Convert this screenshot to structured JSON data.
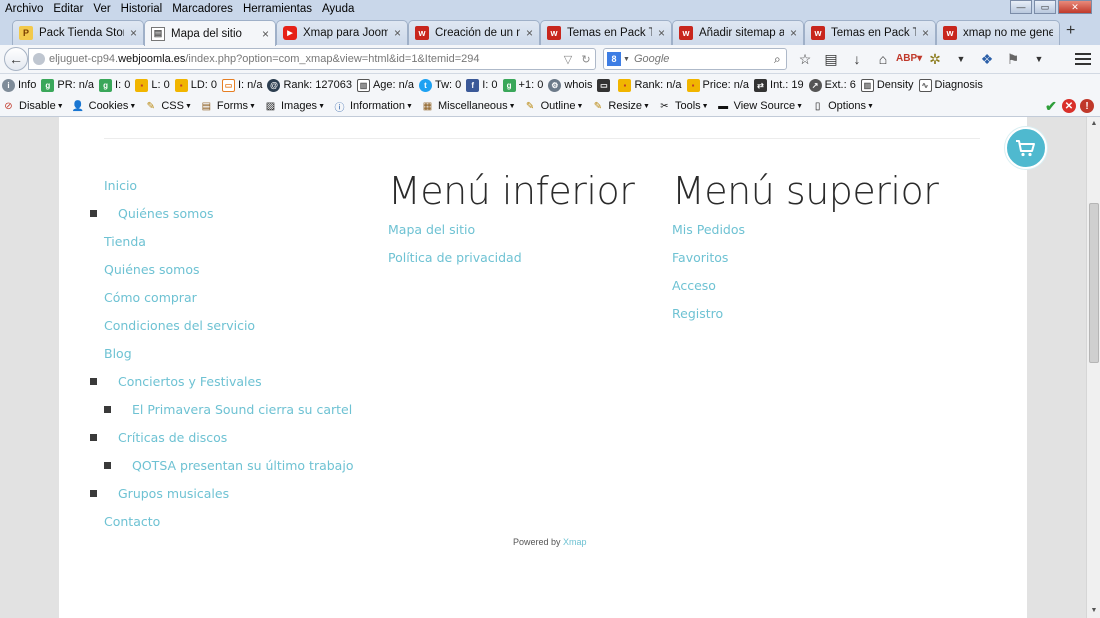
{
  "menubar": {
    "items": [
      "Archivo",
      "Editar",
      "Ver",
      "Historial",
      "Marcadores",
      "Herramientas",
      "Ayuda"
    ]
  },
  "tabs": [
    {
      "label": "Pack Tienda Store...",
      "icon": "pack-icon",
      "active": false
    },
    {
      "label": "Mapa del sitio",
      "icon": "page-icon",
      "active": true
    },
    {
      "label": "Xmap para Joomla...",
      "icon": "youtube-icon",
      "active": false
    },
    {
      "label": "Creación de un m...",
      "icon": "w-icon",
      "active": false
    },
    {
      "label": "Temas en Pack Ti...",
      "icon": "w-icon",
      "active": false
    },
    {
      "label": "Añadir sitemap a ...",
      "icon": "w-icon",
      "active": false
    },
    {
      "label": "Temas en Pack Ti...",
      "icon": "w-icon",
      "active": false
    },
    {
      "label": "xmap no me gene...",
      "icon": "w-icon",
      "active": false
    }
  ],
  "navbar": {
    "url_prefix": "eljuguet-cp94.",
    "url_domain": "webjoomla.es",
    "url_suffix": "/index.php?option=com_xmap&view=html&id=1&Itemid=294",
    "search_placeholder": "Google",
    "search_engine_label": "8"
  },
  "seobar": {
    "items": [
      {
        "icon": "info-icon",
        "text": "Info"
      },
      {
        "icon": "pagerank-icon",
        "text": "PR: n/a"
      },
      {
        "icon": "google-index-icon",
        "text": "I: 0"
      },
      {
        "icon": "links-icon",
        "text": "L: 0"
      },
      {
        "icon": "linkdomain-icon",
        "text": "LD: 0"
      },
      {
        "icon": "bing-index-icon",
        "text": "I: n/a"
      },
      {
        "icon": "alexa-icon",
        "text": "Rank: 127063"
      },
      {
        "icon": "age-icon",
        "text": "Age: n/a"
      },
      {
        "icon": "twitter-icon",
        "text": "Tw: 0"
      },
      {
        "icon": "facebook-icon",
        "text": "I: 0"
      },
      {
        "icon": "googleplus-icon",
        "text": "+1: 0"
      },
      {
        "icon": "whois-icon",
        "text": "whois"
      },
      {
        "icon": "source-icon",
        "text": ""
      },
      {
        "icon": "semrush-rank-icon",
        "text": "Rank: n/a"
      },
      {
        "icon": "semrush-price-icon",
        "text": "Price: n/a"
      },
      {
        "icon": "internal-links-icon",
        "text": "Int.: 19"
      },
      {
        "icon": "external-links-icon",
        "text": "Ext.: 6"
      },
      {
        "icon": "density-icon",
        "text": "Density"
      },
      {
        "icon": "diagnosis-icon",
        "text": "Diagnosis"
      }
    ]
  },
  "devbar": {
    "items": [
      {
        "icon": "disable-icon",
        "text": "Disable"
      },
      {
        "icon": "cookies-icon",
        "text": "Cookies"
      },
      {
        "icon": "css-icon",
        "text": "CSS"
      },
      {
        "icon": "forms-icon",
        "text": "Forms"
      },
      {
        "icon": "images-icon",
        "text": "Images"
      },
      {
        "icon": "information-icon",
        "text": "Information"
      },
      {
        "icon": "miscellaneous-icon",
        "text": "Miscellaneous"
      },
      {
        "icon": "outline-icon",
        "text": "Outline"
      },
      {
        "icon": "resize-icon",
        "text": "Resize"
      },
      {
        "icon": "tools-icon",
        "text": "Tools"
      },
      {
        "icon": "view-source-icon",
        "text": "View Source"
      },
      {
        "icon": "options-icon",
        "text": "Options"
      }
    ]
  },
  "sitemap": {
    "main_menu": [
      {
        "label": "Inicio",
        "level": 0
      },
      {
        "label": "Quiénes somos",
        "level": 1
      },
      {
        "label": "Tienda",
        "level": 0
      },
      {
        "label": "Quiénes somos",
        "level": 0
      },
      {
        "label": "Cómo comprar",
        "level": 0
      },
      {
        "label": "Condiciones del servicio",
        "level": 0
      },
      {
        "label": "Blog",
        "level": 0
      },
      {
        "label": "Conciertos y Festivales",
        "level": 1
      },
      {
        "label": "El Primavera Sound cierra su cartel",
        "level": 2
      },
      {
        "label": "Críticas de discos",
        "level": 1
      },
      {
        "label": "QOTSA presentan su último trabajo",
        "level": 2
      },
      {
        "label": "Grupos musicales",
        "level": 1
      },
      {
        "label": "Contacto",
        "level": 0
      }
    ],
    "bottom_menu": {
      "title": "Menú inferior",
      "links": [
        "Mapa del sitio",
        "Política de privacidad"
      ]
    },
    "top_menu": {
      "title": "Menú superior",
      "links": [
        "Mis Pedidos",
        "Favoritos",
        "Acceso",
        "Registro"
      ]
    },
    "powered_by": "Powered by",
    "powered_link": "Xmap"
  },
  "colors": {
    "link": "#6ec2d3",
    "cart": "#4fb9cf",
    "heading": "#2b2b2b"
  }
}
